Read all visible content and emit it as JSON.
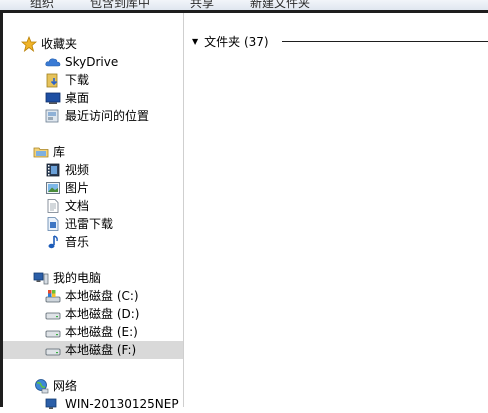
{
  "toolbar": {
    "items": [
      "组织",
      "包含到库中",
      "共享",
      "新建文件夹"
    ]
  },
  "sidebar": {
    "favorites": {
      "label": "收藏夹",
      "items": [
        "SkyDrive",
        "下载",
        "桌面",
        "最近访问的位置"
      ]
    },
    "libraries": {
      "label": "库",
      "items": [
        "视频",
        "图片",
        "文档",
        "迅雷下载",
        "音乐"
      ]
    },
    "computer": {
      "label": "我的电脑",
      "items": [
        "本地磁盘 (C:)",
        "本地磁盘 (D:)",
        "本地磁盘 (E:)",
        "本地磁盘 (F:)"
      ],
      "selected": "本地磁盘 (F:)"
    },
    "network": {
      "label": "网络",
      "items": [
        "WIN-20130125NEP"
      ]
    }
  },
  "content": {
    "group_label": "文件夹 (37)"
  },
  "colors": {
    "selection": "#d9d9d9",
    "frame": "#1e1e1e"
  }
}
